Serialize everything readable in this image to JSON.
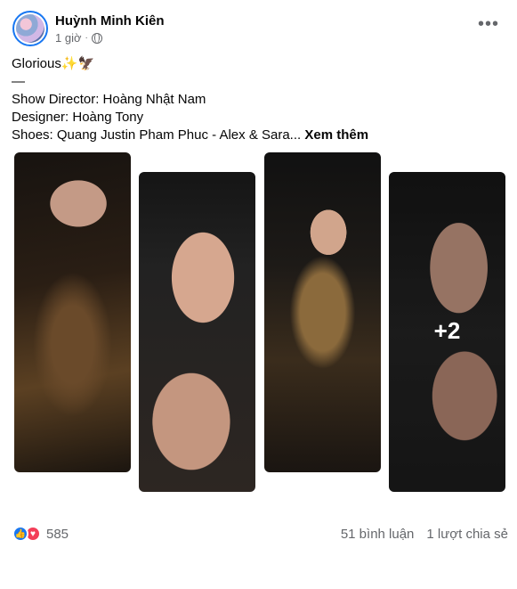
{
  "post": {
    "author": "Huỳnh Minh Kiên",
    "time": "1 giờ",
    "time_separator": "·",
    "menu_label": "•••",
    "caption": {
      "line1": "Glorious✨🦅",
      "line2": "—",
      "line3": "Show Director: Hoàng Nhật Nam",
      "line4": "Designer: Hoàng Tony",
      "line5": "Shoes: Quang Justin Pham Phuc - Alex & Sara...",
      "see_more": "Xem thêm"
    },
    "photos": {
      "extra_count": "+2"
    },
    "reactions": {
      "count": "585",
      "like_icon": "👍",
      "love_icon": "♥",
      "comments": "51 bình luận",
      "shares": "1 lượt chia sẻ"
    }
  },
  "icons": {
    "avatar": "avatar",
    "globe": "globe-icon",
    "more": "more-horizontal-icon",
    "like": "like-icon",
    "love": "love-icon"
  }
}
